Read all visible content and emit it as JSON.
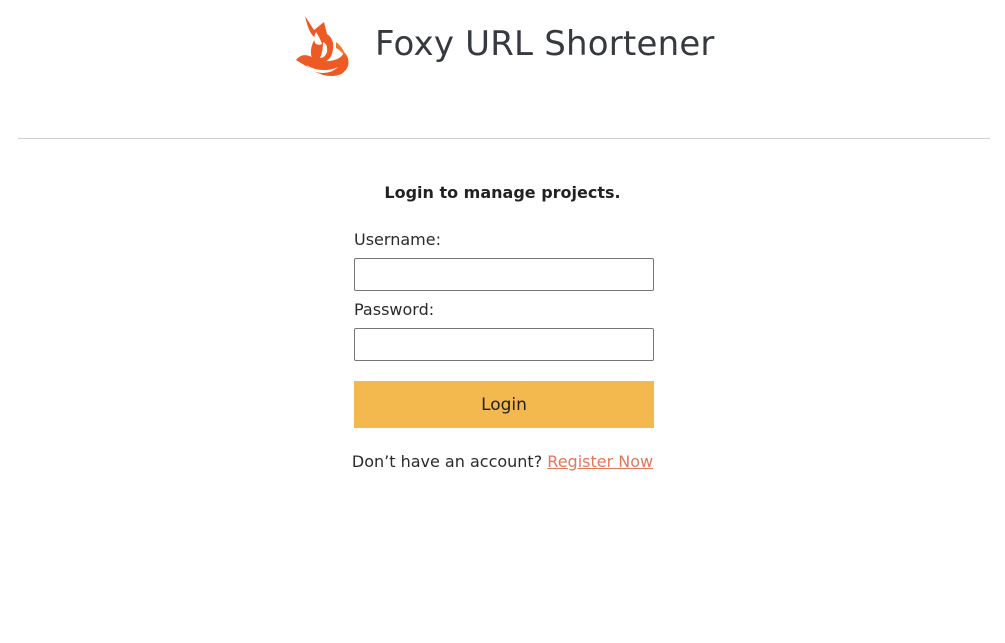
{
  "header": {
    "logo_icon": "fox-logo-icon",
    "title": "Foxy URL Shortener"
  },
  "login": {
    "heading": "Login to manage projects.",
    "username_label": "Username:",
    "username_value": "",
    "password_label": "Password:",
    "password_value": "",
    "submit_label": "Login",
    "register_prompt": "Don’t have an account?",
    "register_link": "Register Now"
  },
  "colors": {
    "accent_button": "#f4b94e",
    "link": "#e0785a",
    "logo_primary": "#ee5a24",
    "title_text": "#36393f",
    "divider": "#cfcfcf"
  }
}
